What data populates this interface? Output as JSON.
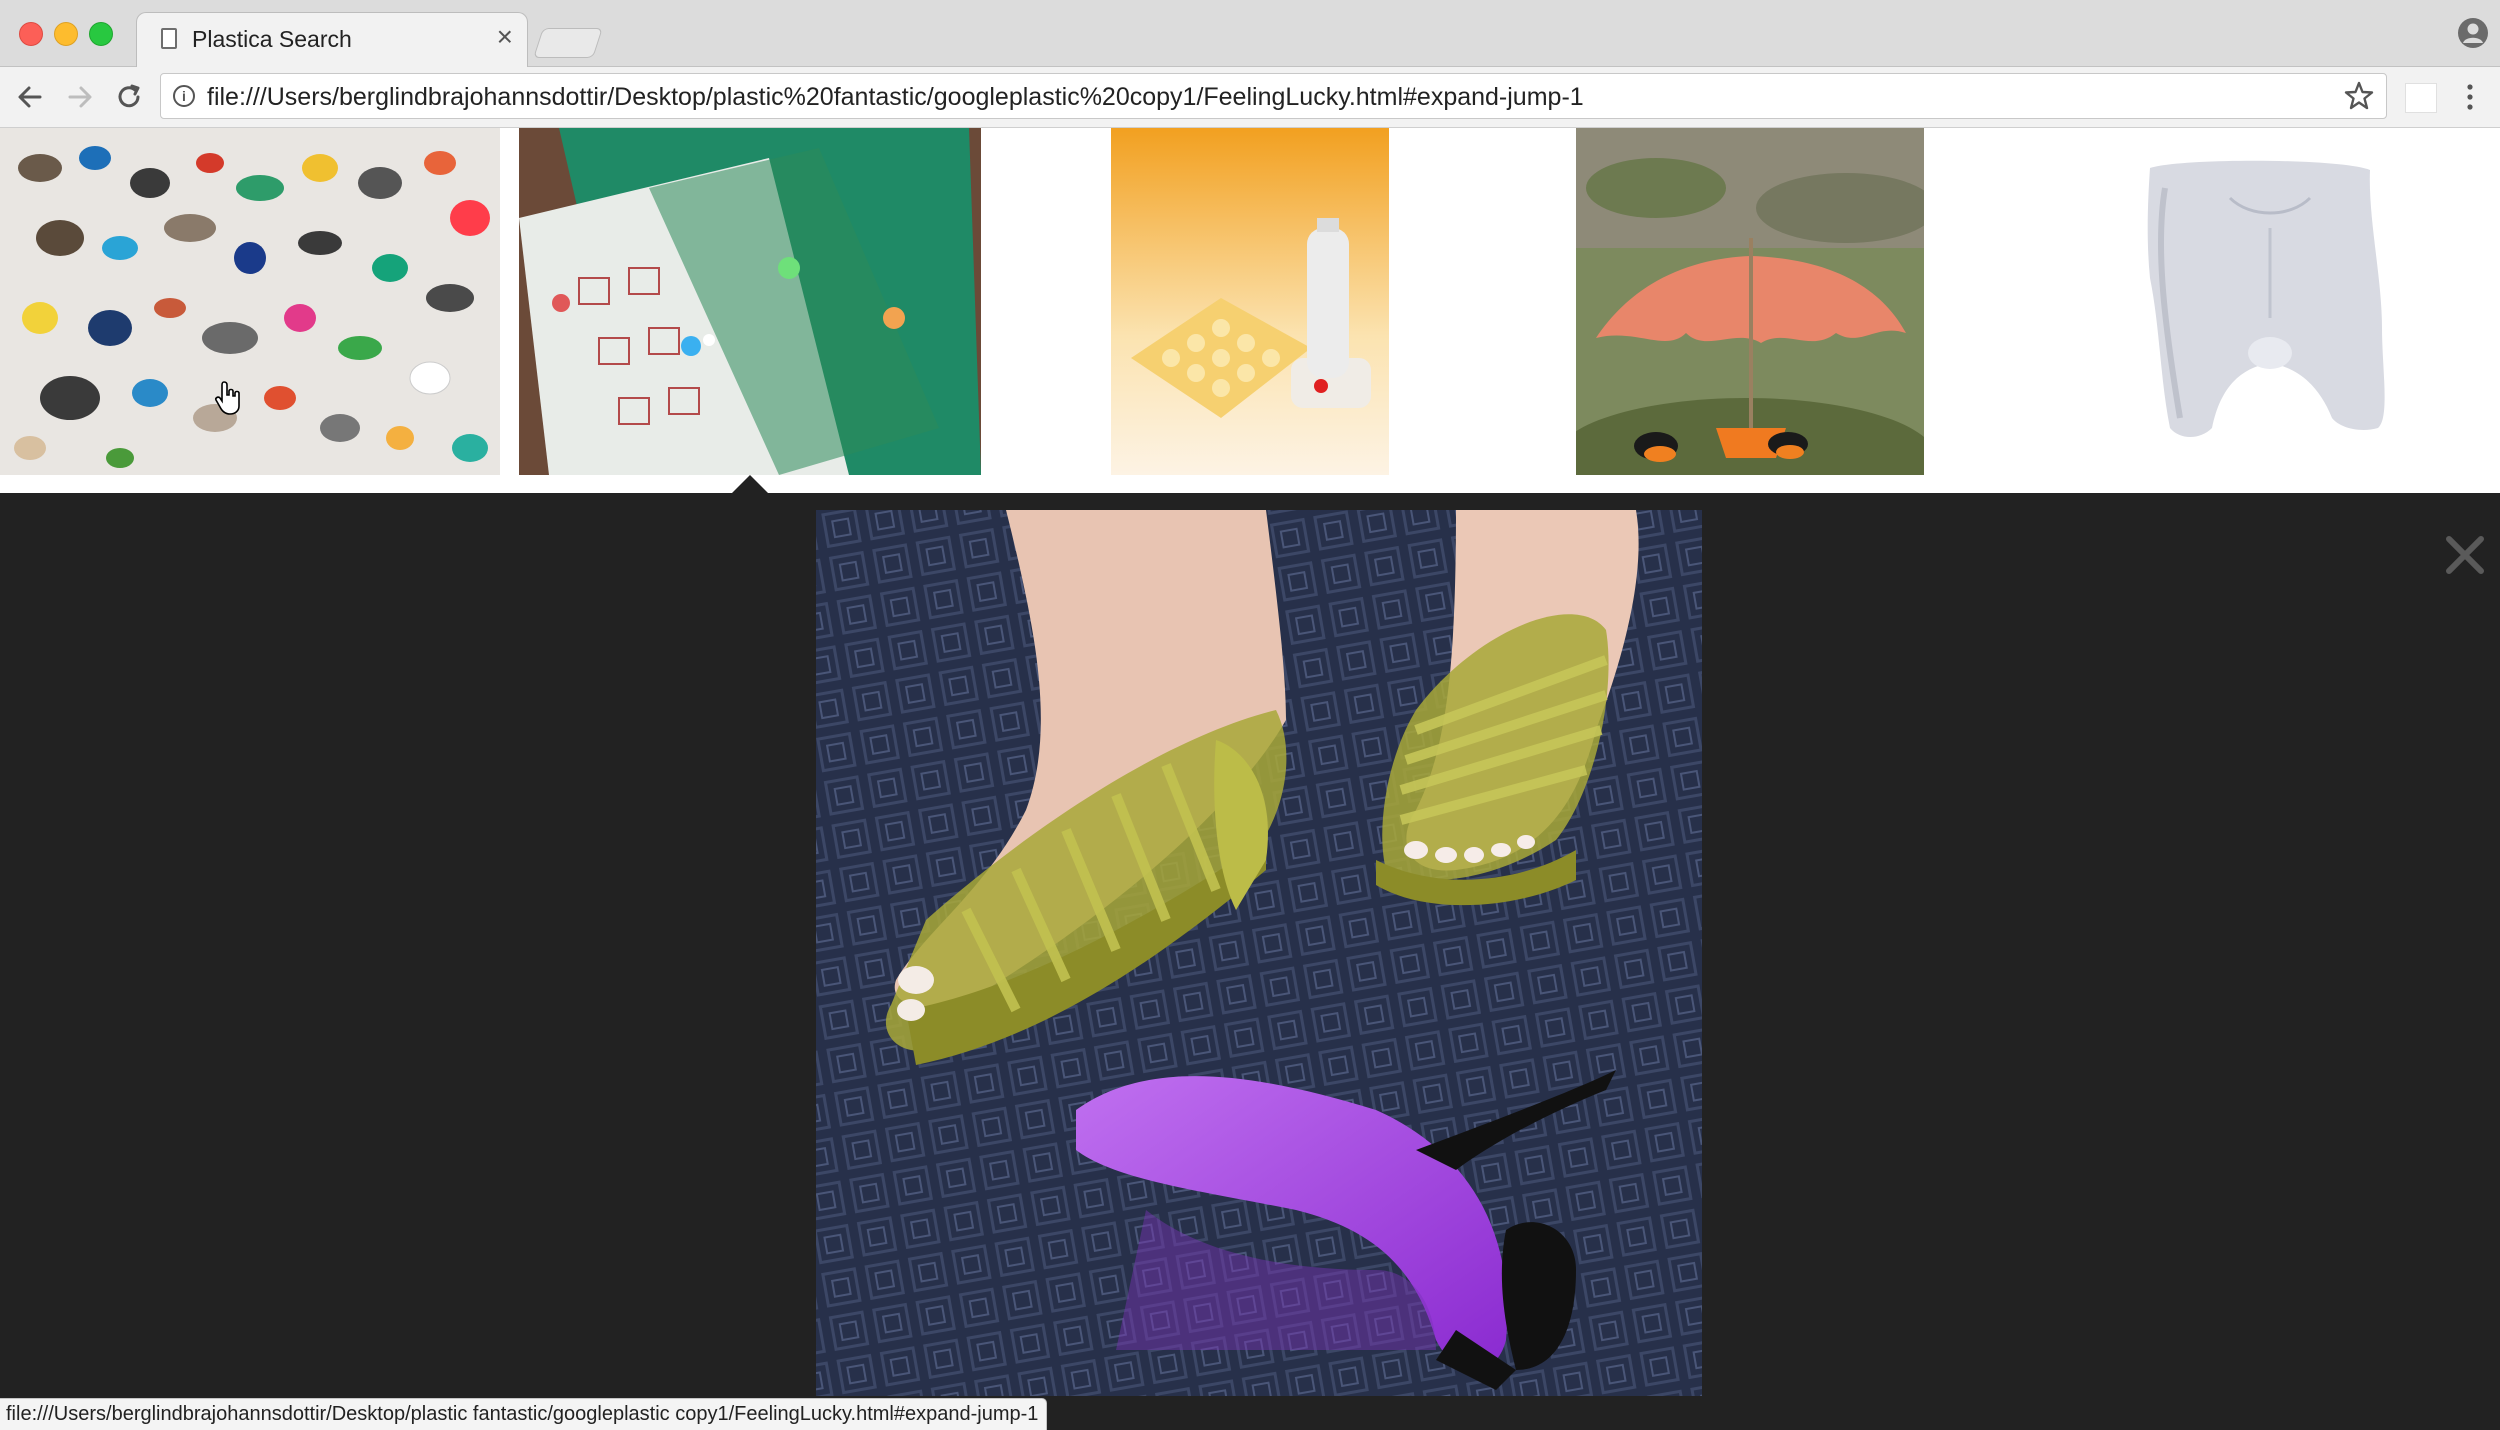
{
  "browser": {
    "tab": {
      "title": "Plastica Search",
      "close_glyph": "×",
      "icon": "document-icon"
    },
    "address_bar": {
      "url": "file:///Users/berglindbrajohannsdottir/Desktop/plastic%20fantastic/googleplastic%20copy1/FeelingLucky.html#expand-jump-1",
      "icon": "info-icon",
      "info_glyph": "i"
    },
    "toolbar_icons": [
      "back-arrow-icon",
      "forward-arrow-icon",
      "reload-icon",
      "bookmark-star-icon",
      "extension-icon",
      "kebab-menu-icon",
      "profile-icon"
    ],
    "status_bar": {
      "text": "file:///Users/berglindbrajohannsdottir/Desktop/plastic fantastic/googleplastic copy1/FeelingLucky.html#expand-jump-1"
    }
  },
  "gallery": {
    "thumbnails": [
      {
        "subject": "plastic debris collection"
      },
      {
        "subject": "green transparent plastic folders"
      },
      {
        "subject": "plastic bottle and ice tray"
      },
      {
        "subject": "orange umbrella bird feeder"
      },
      {
        "subject": "white plastic torso mannequin"
      }
    ],
    "expanded_preview": {
      "subject": "plastic sandals and purple high heel",
      "close_icon": "close-icon"
    }
  },
  "colors": {
    "tab_strip": "#dcdcdc",
    "toolbar": "#f2f2f2",
    "expand_panel": "#222222",
    "close_x": "#5a5a5a"
  }
}
